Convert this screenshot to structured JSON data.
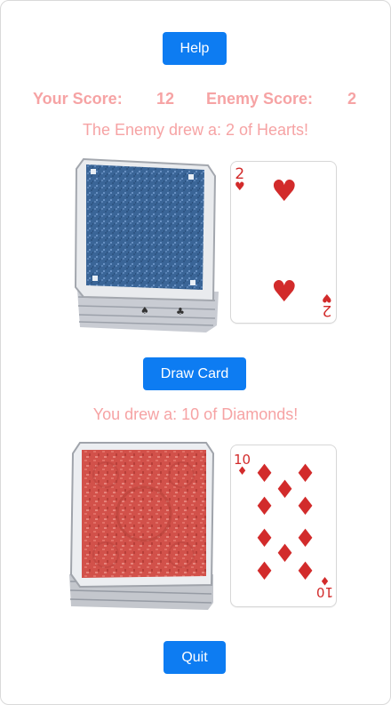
{
  "buttons": {
    "help": "Help",
    "draw": "Draw Card",
    "quit": "Quit"
  },
  "score": {
    "your_label": "Your Score:",
    "your_value": "12",
    "enemy_label": "Enemy Score:",
    "enemy_value": "2"
  },
  "enemy": {
    "message": "The Enemy drew a: 2 of Hearts!",
    "deck_color": "blue",
    "card": {
      "rank": "2",
      "suit": "♥",
      "color": "#d22b2b"
    }
  },
  "player": {
    "message": "You drew a: 10 of Diamonds!",
    "deck_color": "red",
    "card": {
      "rank": "10",
      "suit": "♦",
      "color": "#d22b2b"
    }
  },
  "colors": {
    "button": "#0d7cf2",
    "text_pink": "#f6a3a4",
    "card_red": "#d22b2b",
    "deck_blue": "#3a6597",
    "deck_red": "#d2514a"
  }
}
